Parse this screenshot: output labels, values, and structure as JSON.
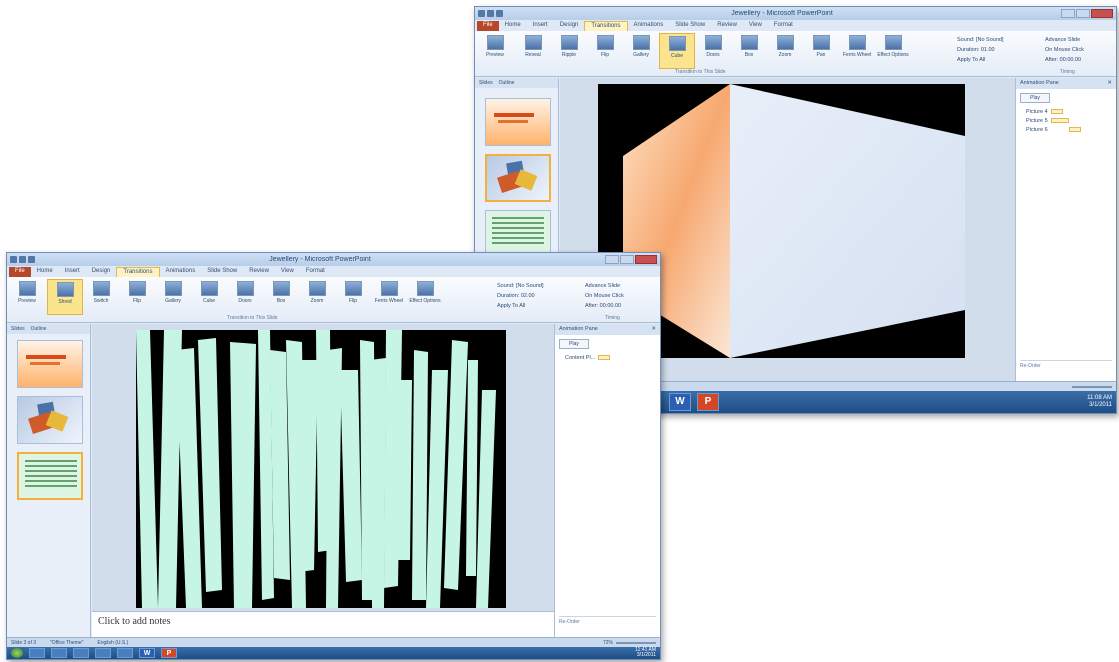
{
  "back_window": {
    "title": "Jewellery - Microsoft PowerPoint",
    "tabs": [
      "File",
      "Home",
      "Insert",
      "Design",
      "Transitions",
      "Animations",
      "Slide Show",
      "Review",
      "View",
      "Format"
    ],
    "active_tab": "Transitions",
    "ribbon": {
      "preview_label": "Preview",
      "transitions": [
        "Reveal",
        "Ripple",
        "Flip",
        "Gallery",
        "Cube",
        "Doors",
        "Box",
        "Zoom",
        "Pan",
        "Ferris Wheel"
      ],
      "selected": "Cube",
      "effect_options": "Effect Options",
      "group_label": "Transition to This Slide",
      "sound_label": "Sound: [No Sound]",
      "duration_label": "Duration: 01.00",
      "apply_all": "Apply To All",
      "advance_label": "Advance Slide",
      "on_click": "On Mouse Click",
      "after_label": "After: 00:00.00",
      "timing_label": "Timing"
    },
    "left_tabs": [
      "Slides",
      "Outline"
    ],
    "anim_pane": {
      "title": "Animation Pane",
      "play": "Play",
      "items": [
        "Picture 4",
        "Picture 5",
        "Picture 6"
      ],
      "footer": "Re-Order"
    },
    "taskbar_clock": [
      "11:08 AM",
      "3/1/2011"
    ]
  },
  "front_window": {
    "title": "Jewellery - Microsoft PowerPoint",
    "tabs": [
      "File",
      "Home",
      "Insert",
      "Design",
      "Transitions",
      "Animations",
      "Slide Show",
      "Review",
      "View",
      "Format"
    ],
    "active_tab": "Transitions",
    "ribbon": {
      "preview_label": "Preview",
      "transitions": [
        "Shred",
        "Switch",
        "Flip",
        "Gallery",
        "Cube",
        "Doors",
        "Box",
        "Zoom",
        "Flip",
        "Ferris Wheel"
      ],
      "selected": "Shred",
      "effect_options": "Effect Options",
      "group_label": "Transition to This Slide",
      "sound_label": "Sound: [No Sound]",
      "duration_label": "Duration: 02.00",
      "apply_all": "Apply To All",
      "advance_label": "Advance Slide",
      "on_click": "On Mouse Click",
      "after_label": "After: 00:00.00",
      "timing_label": "Timing"
    },
    "left_tabs": [
      "Slides",
      "Outline"
    ],
    "notes_placeholder": "Click to add notes",
    "anim_pane": {
      "title": "Animation Pane",
      "play": "Play",
      "items": [
        "Content Pl..."
      ],
      "footer": "Re-Order"
    },
    "status": {
      "slide": "Slide 3 of 3",
      "theme": "\"Office Theme\"",
      "language": "English (U.S.)",
      "zoom": "72%"
    },
    "taskbar_clock": [
      "11:41 AM",
      "3/1/2011"
    ]
  },
  "colors": {
    "accent_tab": "#b7472a",
    "shred_strips": "#c6f5e6",
    "cube_face": "#dfe8f7",
    "cube_side": "#f7b27a"
  }
}
